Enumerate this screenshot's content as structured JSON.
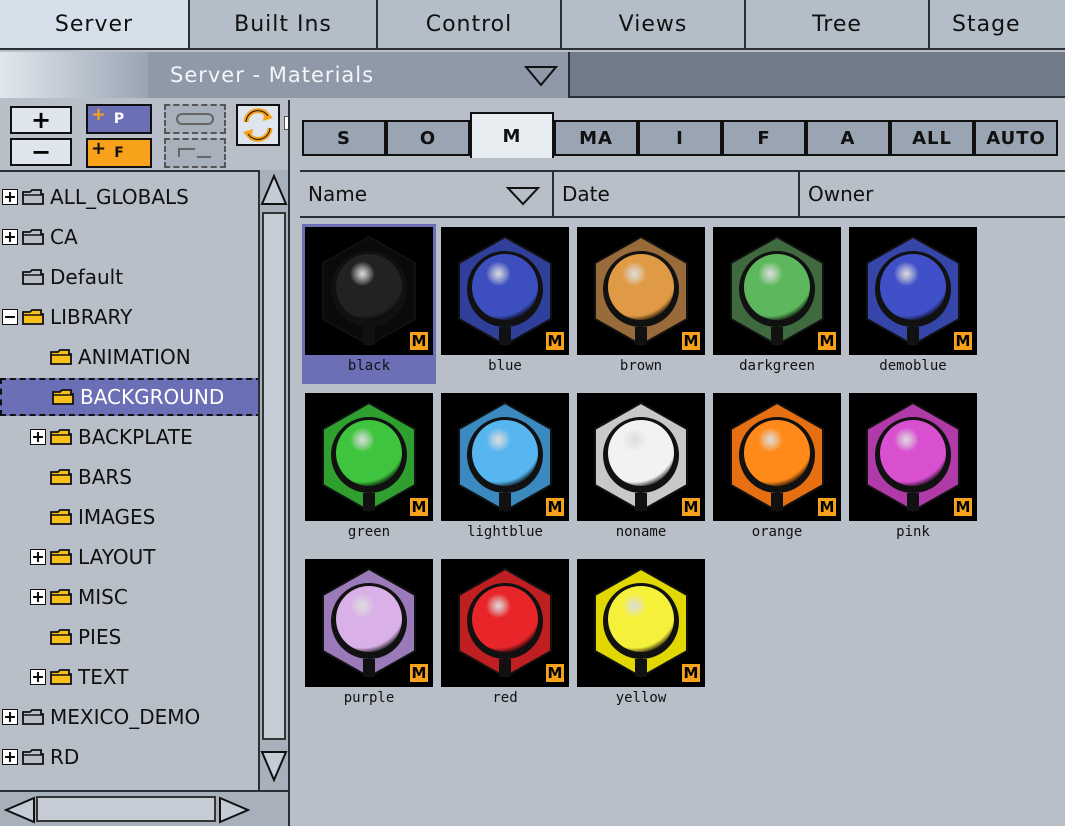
{
  "top_tabs": [
    {
      "label": "Server"
    },
    {
      "label": "Built Ins"
    },
    {
      "label": "Control"
    },
    {
      "label": "Views"
    },
    {
      "label": "Tree"
    },
    {
      "label": "Stage"
    }
  ],
  "dropdown": {
    "label": "Server - Materials"
  },
  "toolbar": {
    "add_label": "+",
    "remove_label": "−",
    "p_label": "P",
    "f_label": "F"
  },
  "tree": [
    {
      "label": "ALL_GLOBALS",
      "expander": "plus"
    },
    {
      "label": "CA",
      "expander": "plus"
    },
    {
      "label": "Default",
      "expander": "none"
    },
    {
      "label": "LIBRARY",
      "expander": "minus"
    },
    {
      "label": "ANIMATION",
      "expander": "none"
    },
    {
      "label": "BACKGROUND",
      "expander": "none"
    },
    {
      "label": "BACKPLATE",
      "expander": "plus"
    },
    {
      "label": "BARS",
      "expander": "none"
    },
    {
      "label": "IMAGES",
      "expander": "none"
    },
    {
      "label": "LAYOUT",
      "expander": "plus"
    },
    {
      "label": "MISC",
      "expander": "plus"
    },
    {
      "label": "PIES",
      "expander": "none"
    },
    {
      "label": "TEXT",
      "expander": "plus"
    },
    {
      "label": "MEXICO_DEMO",
      "expander": "plus"
    },
    {
      "label": "RD",
      "expander": "plus"
    }
  ],
  "type_tabs": [
    {
      "label": "S"
    },
    {
      "label": "O"
    },
    {
      "label": "M"
    },
    {
      "label": "MA"
    },
    {
      "label": "I"
    },
    {
      "label": "F"
    },
    {
      "label": "A"
    },
    {
      "label": "ALL"
    },
    {
      "label": "AUTO"
    }
  ],
  "columns": [
    {
      "label": "Name"
    },
    {
      "label": "Date"
    },
    {
      "label": "Owner"
    }
  ],
  "materials": [
    {
      "name": "black",
      "color": "#222222",
      "hex": "#0a0a0a",
      "selected": true
    },
    {
      "name": "blue",
      "color": "#3d4fbf",
      "hex": "#2f3f9a"
    },
    {
      "name": "brown",
      "color": "#e09a45",
      "hex": "#9a6b3a"
    },
    {
      "name": "darkgreen",
      "color": "#5db85d",
      "hex": "#3f6a3f"
    },
    {
      "name": "demoblue",
      "color": "#4050c8",
      "hex": "#3545a8"
    },
    {
      "name": "green",
      "color": "#3fc43f",
      "hex": "#2fa02f"
    },
    {
      "name": "lightblue",
      "color": "#57b5ef",
      "hex": "#3a8ac0"
    },
    {
      "name": "noname",
      "color": "#f2f2f2",
      "hex": "#c8c8c8"
    },
    {
      "name": "orange",
      "color": "#ff8a1a",
      "hex": "#e66f12"
    },
    {
      "name": "pink",
      "color": "#d84fd0",
      "hex": "#b03aa8"
    },
    {
      "name": "purple",
      "color": "#d9b0e8",
      "hex": "#9a7ab8"
    },
    {
      "name": "red",
      "color": "#e8262a",
      "hex": "#c01f22"
    },
    {
      "name": "yellow",
      "color": "#f5f03a",
      "hex": "#e0d800"
    }
  ],
  "badge": "M"
}
